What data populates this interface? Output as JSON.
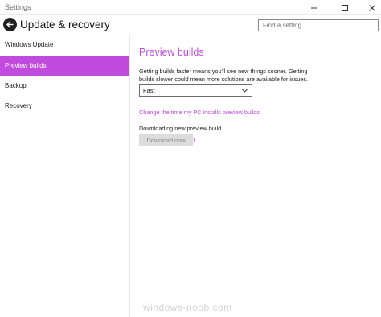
{
  "window": {
    "title": "Settings",
    "minimize_icon": "minimize-icon",
    "maximize_icon": "maximize-icon",
    "close_icon": "close-icon"
  },
  "header": {
    "back_icon": "back-arrow-icon",
    "title": "Update & recovery",
    "search_placeholder": "Find a setting"
  },
  "sidebar": {
    "items": [
      {
        "label": "Windows Update",
        "active": false
      },
      {
        "label": "Preview builds",
        "active": true
      },
      {
        "label": "Backup",
        "active": false
      },
      {
        "label": "Recovery",
        "active": false
      }
    ]
  },
  "main": {
    "section_title": "Preview builds",
    "description": "Getting builds faster means you'll see new things sooner. Getting builds slower could mean more solutions are available for issues.",
    "ring_select": {
      "selected": "Fast"
    },
    "change_link": "Change the time my PC installs preview builds",
    "download_status": "Downloading new preview build",
    "download_button": "Download now"
  },
  "watermark": "windows-noob.com",
  "colors": {
    "accent": "#c04bde",
    "button_disabled_bg": "#dcdcdc",
    "button_disabled_text": "#8c8c8c"
  }
}
